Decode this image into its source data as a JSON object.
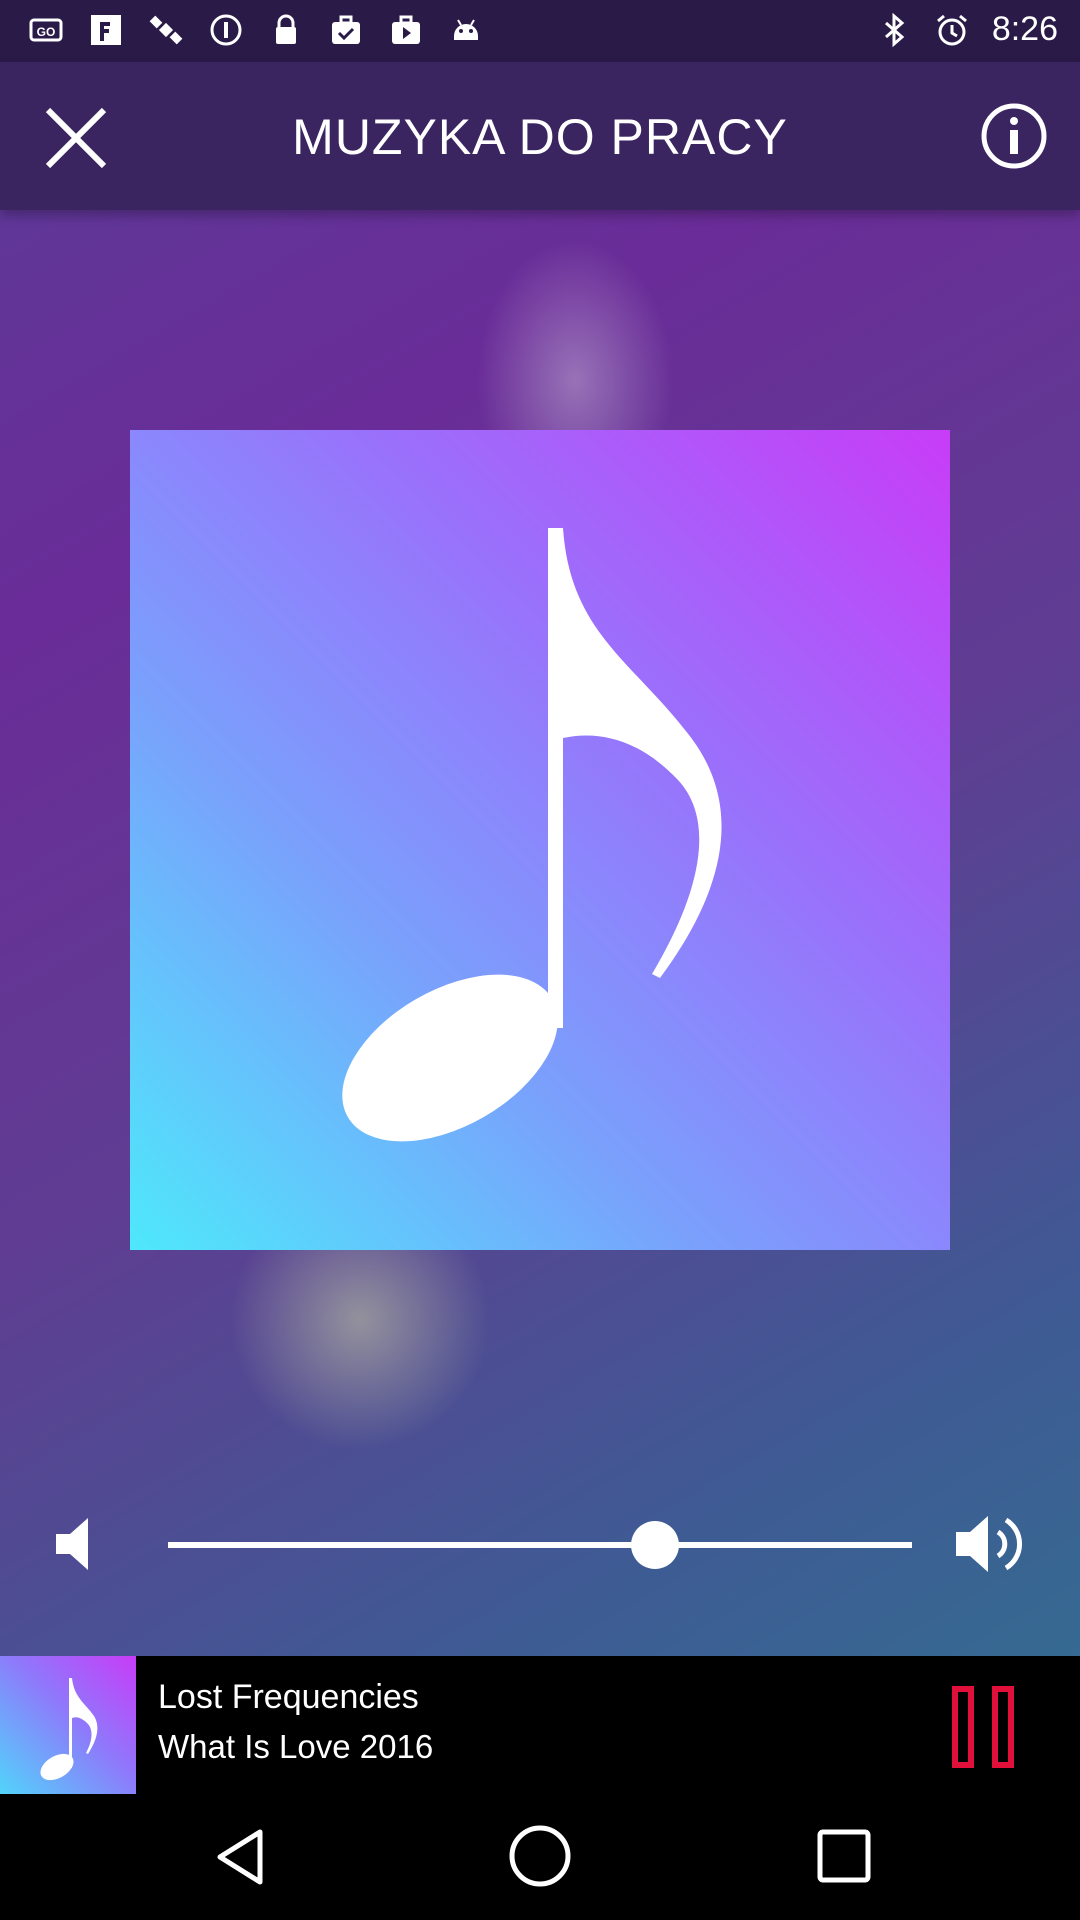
{
  "status_bar": {
    "time": "8:26",
    "left_icons": [
      "go-icon",
      "fake-gps-icon",
      "satellite-icon",
      "data-saver-icon",
      "lock-icon",
      "briefcase-check-icon",
      "play-store-icon",
      "android-icon"
    ],
    "right_icons": [
      "bluetooth-icon",
      "alarm-icon"
    ]
  },
  "app_bar": {
    "title": "MUZYKA DO PRACY",
    "close_icon": "close-icon",
    "info_icon": "info-icon"
  },
  "album_art": {
    "icon": "music-note-icon",
    "colors": [
      "#c83cf8",
      "#9a70fb",
      "#7aa0fc",
      "#4ee8fb"
    ]
  },
  "volume": {
    "low_icon": "volume-low-icon",
    "high_icon": "volume-high-icon",
    "level_fraction": 0.655
  },
  "now_playing": {
    "artist": "Lost Frequencies",
    "title": "What Is Love 2016",
    "pause_icon": "pause-icon",
    "pause_color": "#e0103a"
  },
  "nav_bar": {
    "back_icon": "back-triangle-icon",
    "home_icon": "home-circle-icon",
    "recents_icon": "recents-square-icon"
  }
}
